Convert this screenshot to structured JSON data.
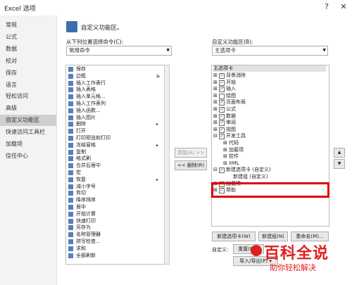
{
  "window": {
    "title": "Excel 选项",
    "help_glyph": "?",
    "close_glyph": "✕"
  },
  "sidebar": {
    "items": [
      {
        "label": "常规"
      },
      {
        "label": "公式"
      },
      {
        "label": "数据"
      },
      {
        "label": "校对"
      },
      {
        "label": "保存"
      },
      {
        "label": "语言"
      },
      {
        "label": "轻松访问"
      },
      {
        "label": "高级"
      },
      {
        "label": "自定义功能区",
        "active": true
      },
      {
        "label": "快速访问工具栏"
      },
      {
        "label": "加载项"
      },
      {
        "label": "信任中心"
      }
    ]
  },
  "header": {
    "title": "自定义功能区。"
  },
  "left": {
    "choose_label": "从下列位置选择命令(C):",
    "choose_value": "常用命令",
    "commands": [
      {
        "label": "保存"
      },
      {
        "label": "边框",
        "sub": "|▸"
      },
      {
        "label": "插入工作表行"
      },
      {
        "label": "插入表格"
      },
      {
        "label": "插入单元格..."
      },
      {
        "label": "插入工作表列"
      },
      {
        "label": "插入函数..."
      },
      {
        "label": "插入图片"
      },
      {
        "label": "删除",
        "sub": "▸"
      },
      {
        "label": "打开"
      },
      {
        "label": "打印预览和打印"
      },
      {
        "label": "冻结窗格",
        "sub": "▸"
      },
      {
        "label": "复制"
      },
      {
        "label": "格式刷"
      },
      {
        "label": "合并后居中"
      },
      {
        "label": "宏"
      },
      {
        "label": "恢复",
        "sub": "▸"
      },
      {
        "label": "减小字号"
      },
      {
        "label": "剪切"
      },
      {
        "label": "降序排序"
      },
      {
        "label": "居中"
      },
      {
        "label": "开始计算"
      },
      {
        "label": "快速打印"
      },
      {
        "label": "另存为"
      },
      {
        "label": "名称管理器"
      },
      {
        "label": "拼写检查..."
      },
      {
        "label": "求和"
      },
      {
        "label": "全部刷新"
      }
    ]
  },
  "middle": {
    "add_label": "添加(A) >>",
    "remove_label": "<< 删除(R)"
  },
  "right": {
    "customize_label": "自定义功能区(B):",
    "customize_value": "主选项卡",
    "tree_header": "主选项卡",
    "tree": [
      {
        "label": "背景消除",
        "expander": "⊞",
        "checked": true,
        "level": 0
      },
      {
        "label": "开始",
        "expander": "⊞",
        "checked": true,
        "level": 0
      },
      {
        "label": "插入",
        "expander": "⊞",
        "checked": true,
        "level": 0
      },
      {
        "label": "绘图",
        "expander": "⊞",
        "checked": false,
        "level": 0
      },
      {
        "label": "页面布局",
        "expander": "⊞",
        "checked": true,
        "level": 0
      },
      {
        "label": "公式",
        "expander": "⊞",
        "checked": true,
        "level": 0
      },
      {
        "label": "数据",
        "expander": "⊞",
        "checked": true,
        "level": 0
      },
      {
        "label": "审阅",
        "expander": "⊞",
        "checked": true,
        "level": 0
      },
      {
        "label": "视图",
        "expander": "⊞",
        "checked": true,
        "level": 0
      },
      {
        "label": "开发工具",
        "expander": "⊟",
        "checked": true,
        "level": 0
      },
      {
        "label": "代码",
        "expander": "⊞",
        "level": 1
      },
      {
        "label": "加载项",
        "expander": "⊞",
        "level": 1
      },
      {
        "label": "控件",
        "expander": "⊞",
        "level": 1
      },
      {
        "label": "XML",
        "expander": "⊞",
        "level": 1
      },
      {
        "label": "新建选项卡 (自定义)",
        "expander": "⊟",
        "checked": true,
        "level": 0
      },
      {
        "label": "新建组 (自定义)",
        "level": 2
      },
      {
        "label": "加载项",
        "expander": "⊞",
        "checked": true,
        "level": 0
      },
      {
        "label": "帮助",
        "expander": "⊞",
        "checked": true,
        "level": 0
      }
    ],
    "new_tab_label": "新建选项卡(W)",
    "new_group_label": "新建组(N)",
    "rename_label": "重命名(M)...",
    "customize_row_label": "自定义:",
    "reset_label": "重置(E) ▾",
    "import_export_label": "导入/导出(P) ▾",
    "up_glyph": "▲",
    "down_glyph": "▼"
  },
  "watermark": {
    "main": "百科全说",
    "sub": "助你轻松解决"
  }
}
